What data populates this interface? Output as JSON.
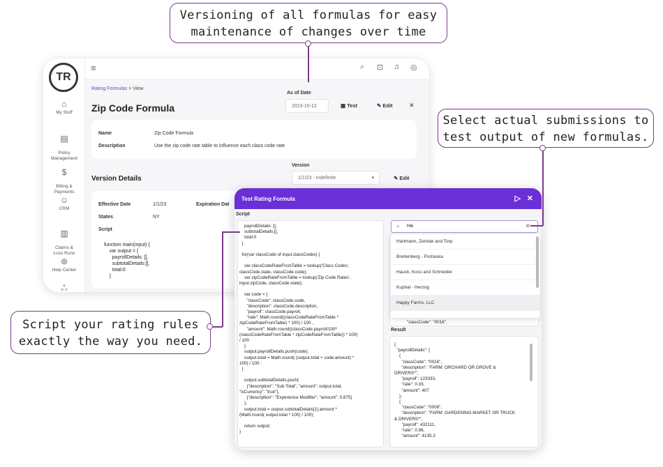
{
  "callouts": {
    "versioning": "Versioning of all formulas for easy\nmaintenance of changes over time",
    "submissions": "Select actual submissions to\ntest output of new formulas.",
    "script": "Script your rating rules\nexactly the way you need."
  },
  "colors": {
    "accent": "#6a2fd6",
    "callout_border": "#7a3a8c"
  },
  "sidebar": {
    "logo_text": "TR",
    "items": [
      {
        "icon": "home-icon",
        "glyph": "⌂",
        "label": "My Stuff"
      },
      {
        "icon": "document-icon",
        "glyph": "▤",
        "label": "Policy\nManagement"
      },
      {
        "icon": "dollar-icon",
        "glyph": "$",
        "label": "Billing &\nPayments"
      },
      {
        "icon": "contacts-icon",
        "glyph": "☺",
        "label": "CRM"
      },
      {
        "icon": "clipboard-icon",
        "glyph": "▥",
        "label": "Claims &\nLoss Runs"
      },
      {
        "icon": "help-icon",
        "glyph": "⊛",
        "label": "Help Center"
      },
      {
        "icon": "more-icon",
        "glyph": "ஃ",
        "label": ""
      }
    ]
  },
  "topbar": {
    "icons": [
      "search-icon",
      "inbox-icon",
      "bell-icon",
      "user-icon"
    ]
  },
  "page": {
    "breadcrumb_link": "Rating Formulas",
    "breadcrumb_sep": ">",
    "breadcrumb_current": "View",
    "title": "Zip Code Formula",
    "as_of_label": "As of Date",
    "as_of_value": "2023-10-12",
    "test_label": "Test",
    "edit_label": "Edit",
    "close_glyph": "✕",
    "name_label": "Name",
    "name_value": "Zip Code Formula",
    "description_label": "Description",
    "description_value": "Use the zip code rate table to influence each class code rate",
    "version_label": "Version",
    "version_value": "1/1/23 - Indefinite",
    "version_details_title": "Version Details",
    "edit2_label": "Edit",
    "effective_label": "Effective Date",
    "effective_value": "1/1/23",
    "expiration_label": "Expiration Dat",
    "states_label": "States",
    "states_value": "NY",
    "script_label": "Script",
    "script_code": "function main(input) {\n    var output = {\n      payrollDetails: [],\n      subtotalDetails:[],\n      total:0\n    }"
  },
  "modal": {
    "title": "Test Rating Formula",
    "script_label": "Script",
    "script_code": "    payrollDetails: [],\n    subtotalDetails:[],\n    total:0\n  }\n\n  for(var classCode of input.classCodes) {\n\n    var classCodeRateFromTable = lookup('Class Codes',\nclassCode.state, classCode.code);\n    var zipCodeRateFromTable = lookup('Zip Code Rates',\ninput.zipCode, classCode.state);\n\n    var code = {\n      \"classCode\": classCode.code,\n      \"description\": classCode.description,\n      \"payroll\": classCode.payroll,\n      \"rate\": Math.round((classCodeRateFromTable *\nzipCodeRateFromTable) * 100) / 100 ,\n      \"amount\": Math.round((classCode.payroll/100*\n(classCodeRateFromTable * zipCodeRateFromTable)) * 100)\n/ 100\n    }\n    output.payrollDetails.push(code);\n    output.total = Math.round( (output.total + code.amount) *\n100) / 100 ;\n  }\n\n    output.subtotalDetails.push(\n      {\"description\": \"Sub Total\", \"amount\": output.total,\n\"isCurrency\": \"true\"},\n      {\"description\": \"Experience Modifier\", \"amount\": 0.875}\n    );\n    output.total = output.subtotalDetails[1].amount *\n(Math.round( output.total * 100) / 100);\n\n    return output;\n}",
    "search_value": "Ha",
    "search_options": [
      "Hartmann, Zemlak and Torp",
      "Breitenberg - Prohaska",
      "Hauck, Koss and Schneider",
      "Kuphal - Herzog",
      "Happy Farms, LLC"
    ],
    "input_peek": "\"classCode\": \"0016\",",
    "result_label": "Result",
    "result_code": "{\n  \"payrollDetails\": [\n    {\n      \"classCode\": \"0016\",\n      \"description\": \"FARM: ORCHARD OR GROVE &\nDRIVERS*\",\n      \"payroll\": 123333,\n      \"rate\": 0.33,\n      \"amount\": 407\n    },\n    {\n      \"classCode\": \"0008\",\n      \"description\": \"FARM: GARDENING-MARKET OR TRUCK\n& DRIVERS*\",\n      \"payroll\": 432111,\n      \"rate\": 0.96,\n      \"amount\": 4135.3"
  }
}
